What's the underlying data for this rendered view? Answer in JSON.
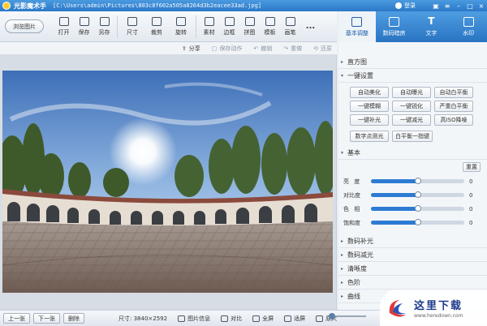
{
  "titlebar": {
    "app_name": "光影魔术手",
    "file_path": "[C:\\Users\\admin\\Pictures\\803c8f602a505a8264d3b2eacee33ad.jpg]",
    "login": "登录"
  },
  "toolbar": {
    "browse": "浏览图片",
    "tools": [
      {
        "label": "打开",
        "icon": "folder-icon"
      },
      {
        "label": "保存",
        "icon": "save-icon"
      },
      {
        "label": "另存",
        "icon": "save-as-icon"
      },
      {
        "label": "尺寸",
        "icon": "resize-icon"
      },
      {
        "label": "裁剪",
        "icon": "crop-icon"
      },
      {
        "label": "旋转",
        "icon": "rotate-icon"
      },
      {
        "label": "素材",
        "icon": "material-icon"
      },
      {
        "label": "边框",
        "icon": "border-icon"
      },
      {
        "label": "拼图",
        "icon": "collage-icon"
      },
      {
        "label": "模板",
        "icon": "template-icon"
      },
      {
        "label": "画笔",
        "icon": "brush-icon"
      },
      {
        "label": "...",
        "icon": "more-icon"
      }
    ]
  },
  "right_tabs": [
    {
      "label": "基本调整",
      "icon": "adjust-icon",
      "active": true
    },
    {
      "label": "数码暗房",
      "icon": "camera-icon",
      "active": false
    },
    {
      "label": "文字",
      "icon": "text-icon",
      "active": false
    },
    {
      "label": "水印",
      "icon": "watermark-icon",
      "active": false
    }
  ],
  "subbar": {
    "share": "分享",
    "save_action": "保存动作",
    "undo": "撤销",
    "redo": "重做",
    "restore": "还原"
  },
  "panel": {
    "histogram": "直方图",
    "one_click": "一键设置",
    "presets": [
      "自动美化",
      "自动曝光",
      "自动白平衡",
      "一键模糊",
      "一键锐化",
      "严重白平衡",
      "一键补光",
      "一键减光",
      "高ISO降噪"
    ],
    "presets2": [
      "数字点测光",
      "白平衡一指键"
    ],
    "basic": "基本",
    "reset": "重置",
    "sliders": [
      {
        "label": "亮 度",
        "value": 0,
        "pos": 0.5
      },
      {
        "label": "对比度",
        "value": 0,
        "pos": 0.5
      },
      {
        "label": "色 相",
        "value": 0,
        "pos": 0.5
      },
      {
        "label": "饱和度",
        "value": 0,
        "pos": 0.5
      }
    ],
    "more_sections": [
      "数码补光",
      "数码减光",
      "清晰度",
      "色阶",
      "曲线"
    ]
  },
  "bottombar": {
    "prev": "上一张",
    "next": "下一张",
    "delete": "删除",
    "size": "尺寸: 3840×2592",
    "image_info": "图片信息",
    "compare": "对比",
    "fullscreen": "全屏",
    "fit": "适屏",
    "original": "原大"
  },
  "watermark": {
    "title": "这里下载",
    "url": "www.heredown.com"
  }
}
